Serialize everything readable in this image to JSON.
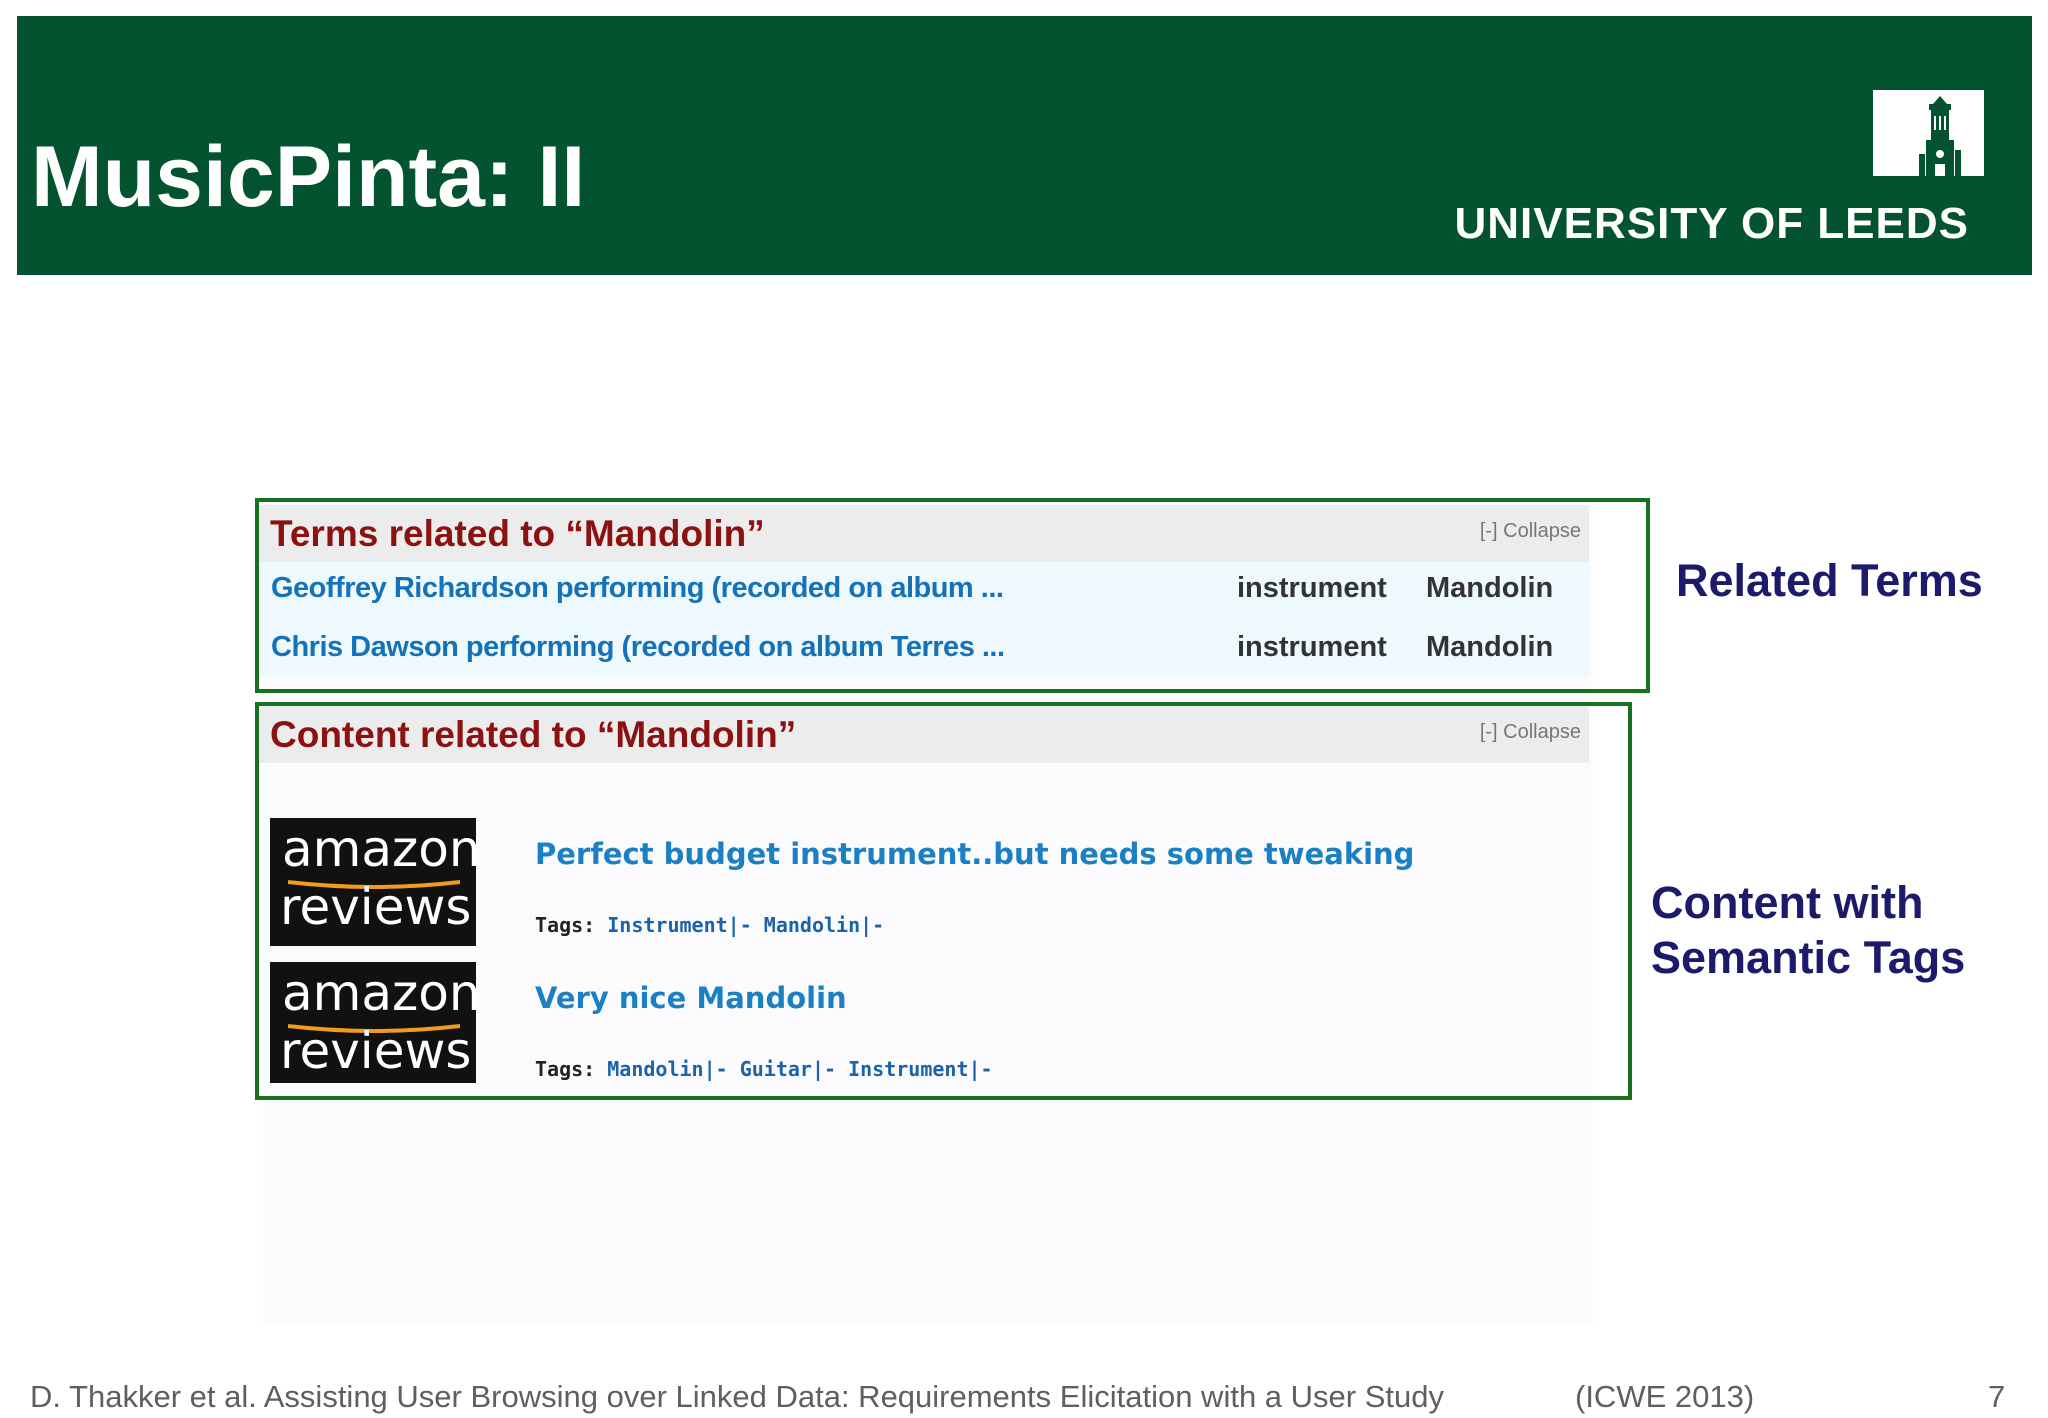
{
  "header": {
    "title": "MusicPinta: II",
    "logo_text": "UNIVERSITY OF LEEDS"
  },
  "terms_section": {
    "title": "Terms related to “Mandolin”",
    "collapse_label": "[-] Collapse",
    "rows": [
      {
        "link": "Geoffrey Richardson performing (recorded on album ...",
        "predicate": "instrument",
        "object": "Mandolin"
      },
      {
        "link": "Chris Dawson performing (recorded on album Terres ...",
        "predicate": "instrument",
        "object": "Mandolin"
      }
    ]
  },
  "content_section": {
    "title": "Content related to “Mandolin”",
    "collapse_label": "[-] Collapse",
    "reviews": [
      {
        "logo_line1": "amazon",
        "logo_line2": "reviews",
        "title": "Perfect budget instrument..but needs some tweaking",
        "tags_label": "Tags:",
        "tags": "Instrument|- Mandolin|-"
      },
      {
        "logo_line1": "amazon",
        "logo_line2": "reviews",
        "title": "Very nice Mandolin",
        "tags_label": "Tags:",
        "tags": "Mandolin|- Guitar|- Instrument|-"
      }
    ]
  },
  "annotations": {
    "related_terms": "Related Terms",
    "content_line1": "Content with",
    "content_line2": "Semantic Tags"
  },
  "footer": {
    "citation": "D. Thakker et al. Assisting User Browsing over Linked Data: Requirements Elicitation with a User Study",
    "venue": "(ICWE 2013)",
    "page_number": "7"
  },
  "colors": {
    "header_bg": "#035230",
    "box_border": "#17711f",
    "section_title": "#8c1111",
    "link": "#1572b8",
    "annotation": "#1c1a6a"
  }
}
